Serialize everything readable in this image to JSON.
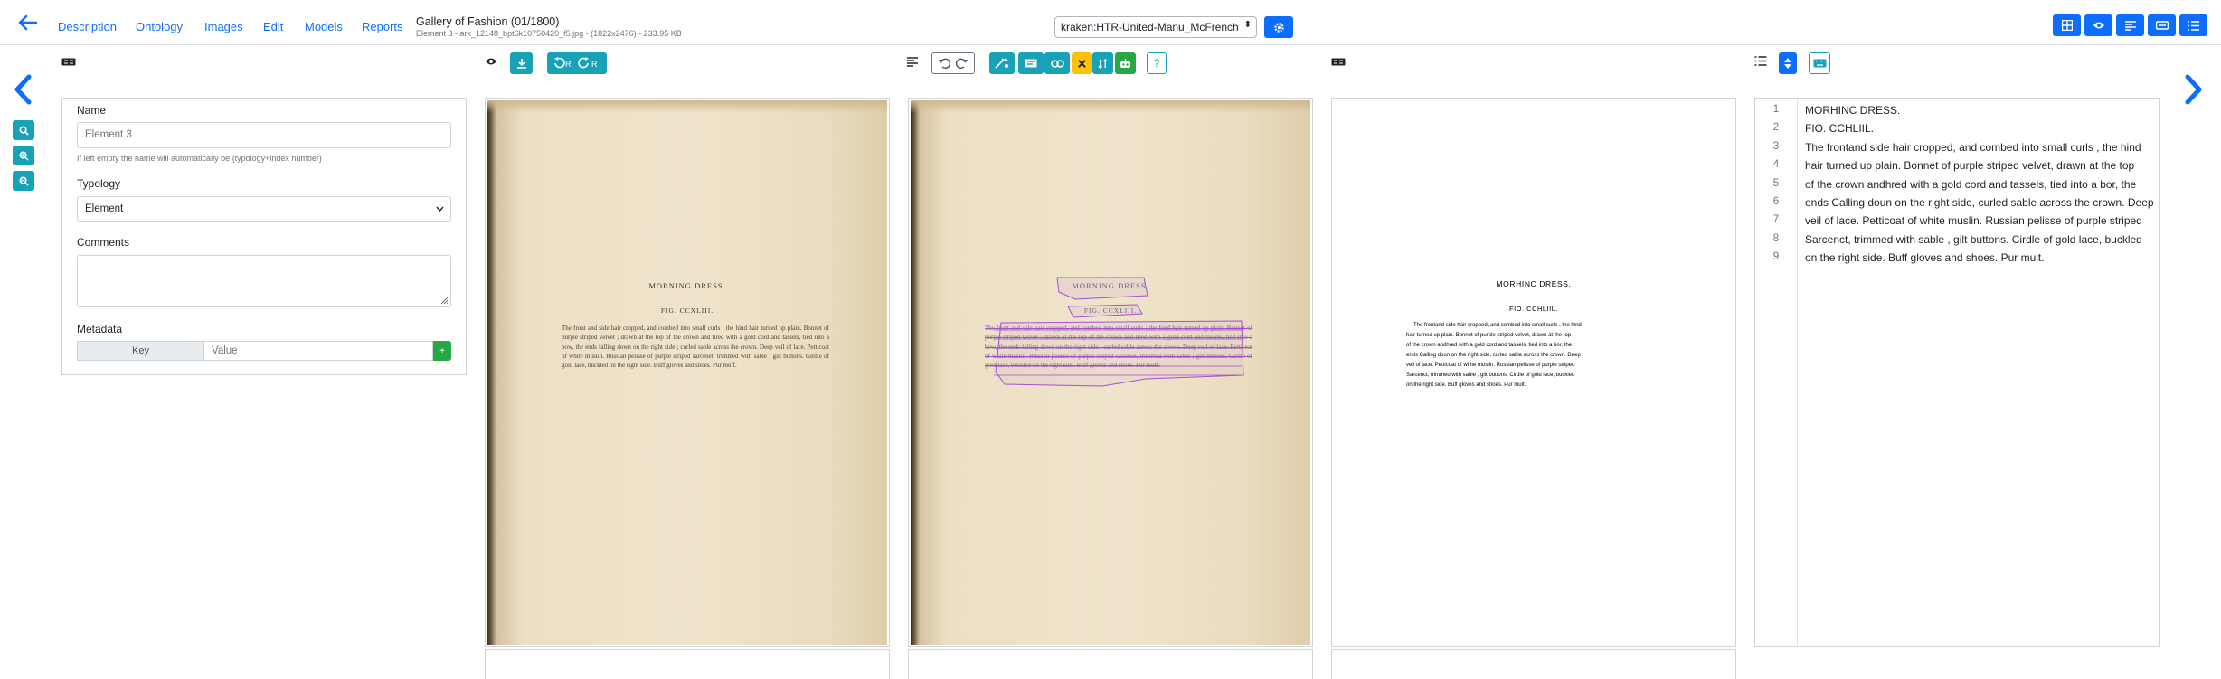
{
  "nav": {
    "links": [
      "Description",
      "Ontology",
      "Images",
      "Edit",
      "Models",
      "Reports"
    ],
    "title": "Gallery of Fashion (01/1800)",
    "subtitle": "Element 3 - ark_12148_bpt6k10750420_f5.jpg - (1822x2476) - 233.95 KB",
    "model": "kraken:HTR-United-Manu_McFrench"
  },
  "form": {
    "name_label": "Name",
    "name_placeholder": "Element 3",
    "name_hint": "If left empty the name will automatically be {typology+index number}",
    "typology_label": "Typology",
    "typology_value": "Element",
    "comments_label": "Comments",
    "metadata_label": "Metadata",
    "meta_key": "Key",
    "meta_value_placeholder": "Value",
    "meta_add": "+"
  },
  "toolbar": {
    "help": "?"
  },
  "page": {
    "heading": "MORNING DRESS.",
    "fig": "FIG. CCXLIII.",
    "body": "The front and side hair cropped, and combed into small curls ; the hind hair turned up plain. Bonnet of purple striped velvet ; drawn at the top of the crown and tired with a gold cord and tassels, tied into a bow, the ends falling down on the right side ; curled sable across the crown. Deep veil of lace. Petticoat of white muslin. Russian pelisse of purple striped sarcenet, trimmed with sable ; gilt buttons. Girdle of gold lace, buckled on the right side. Buff gloves and shoes. Pur muff."
  },
  "ocr_preview": {
    "lines": [
      "MORHINC DRESS.",
      "FIO. CCHLIIL.",
      "The frontand side hair cropped, and combed into small curls , the hind",
      "hair turned up plain. Bonnet of purple striped velvet, drawn at the top",
      "of the crown andhred with a gold cord and tassels, tied into a bor, the",
      "ends Calling doun on the right side, curled sable across the crown. Deep",
      "veil of lace. Petticoat of white muslin. Russian pelisse of purple striped",
      "Sarcenct, trimmed with sable , gilt buttons. Cirdle of gold lace, buckled",
      "on the right side. Buff gloves and shoes. Pur mult."
    ]
  },
  "transcription": {
    "lines": [
      {
        "n": "1",
        "text": "MORHINC DRESS."
      },
      {
        "n": "2",
        "text": "FIO. CCHLIIL."
      },
      {
        "n": "3",
        "text": "The frontand side hair cropped, and combed into small curls , the hind"
      },
      {
        "n": "4",
        "text": "hair turned up plain. Bonnet of purple striped velvet, drawn at the top"
      },
      {
        "n": "5",
        "text": "of the crown andhred with a gold cord and tassels, tied into a bor, the"
      },
      {
        "n": "6",
        "text": "ends Calling doun on the right side, curled sable across the crown. Deep"
      },
      {
        "n": "7",
        "text": "veil of lace. Petticoat of white muslin. Russian pelisse of purple striped"
      },
      {
        "n": "8",
        "text": "Sarcenct, trimmed with sable , gilt buttons. Cirdle of gold lace, buckled"
      },
      {
        "n": "9",
        "text": "on the right side. Buff gloves and shoes. Pur mult."
      }
    ]
  },
  "colors": {
    "primary": "#0d6efd",
    "teal": "#17a2b8",
    "yellow": "#ffc107",
    "green": "#28a745",
    "segmentation": "#a44fd6"
  }
}
